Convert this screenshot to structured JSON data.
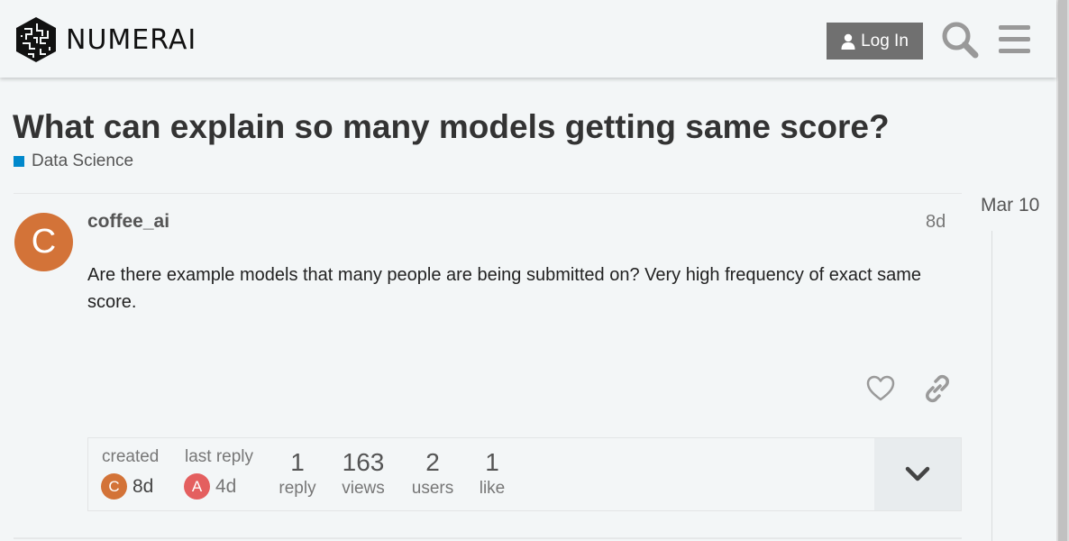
{
  "header": {
    "brand": "NUMERAI",
    "login_label": "Log In"
  },
  "topic": {
    "title": "What can explain so many models getting same score?",
    "category": "Data Science",
    "category_color": "#0088cc"
  },
  "post": {
    "avatar_letter": "C",
    "avatar_color": "#d37338",
    "username": "coffee_ai",
    "age": "8d",
    "body": "Are there example models that many people are being submitted on? Very high frequency of exact same score."
  },
  "summary": {
    "created_label": "created",
    "created_avatar_letter": "C",
    "created_time": "8d",
    "last_reply_label": "last reply",
    "last_reply_avatar_letter": "A",
    "last_reply_avatar_color": "#e45f5f",
    "last_reply_time": "4d",
    "stats": [
      {
        "num": "1",
        "label": "reply"
      },
      {
        "num": "163",
        "label": "views"
      },
      {
        "num": "2",
        "label": "users"
      },
      {
        "num": "1",
        "label": "like"
      }
    ]
  },
  "timeline": {
    "date": "Mar 10"
  },
  "icons": {
    "login": "user-icon",
    "search": "search-icon",
    "menu": "hamburger-icon",
    "like": "heart-icon",
    "share": "link-icon",
    "expand": "chevron-down-icon"
  }
}
